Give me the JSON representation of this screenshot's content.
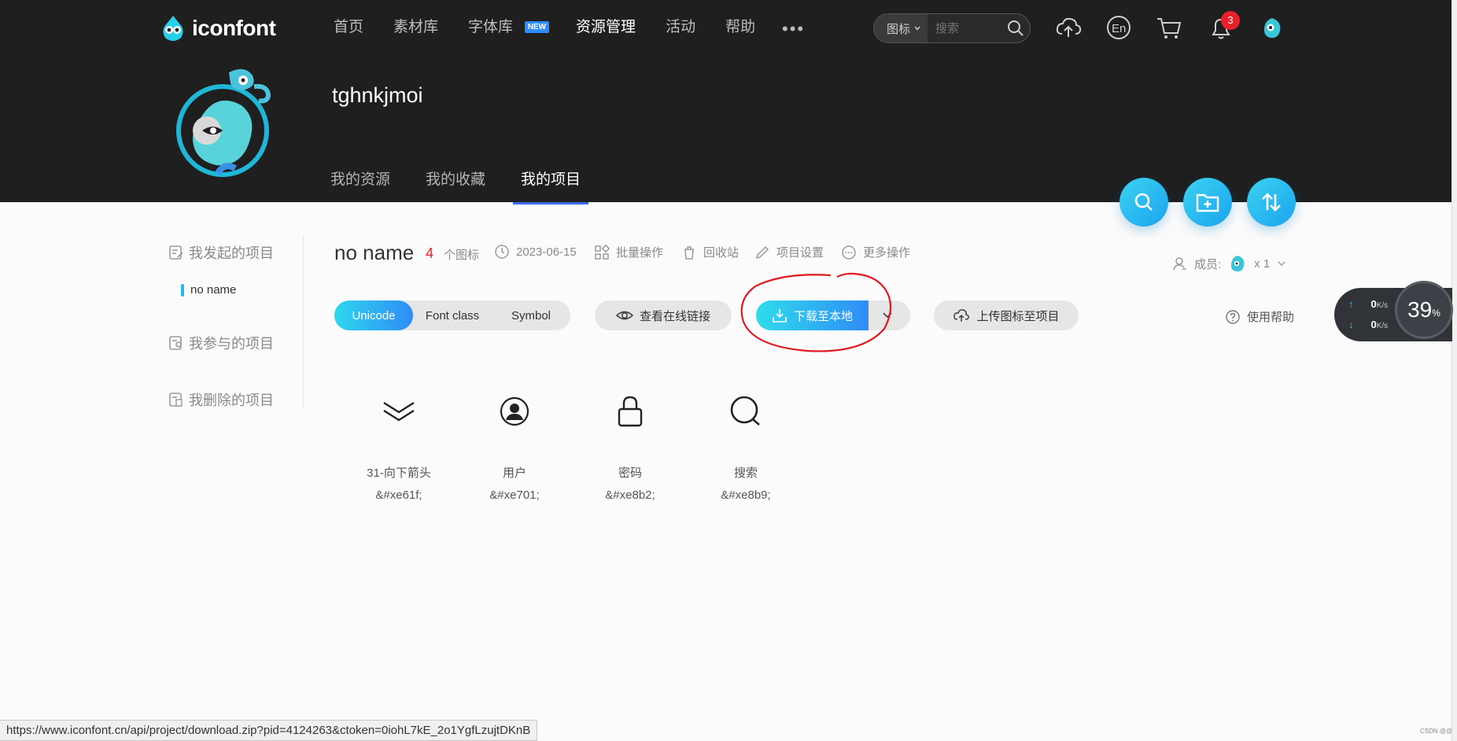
{
  "brand": {
    "name": "iconfont"
  },
  "topnav": {
    "items": [
      {
        "label": "首页"
      },
      {
        "label": "素材库"
      },
      {
        "label": "字体库"
      },
      {
        "label": "资源管理"
      },
      {
        "label": "活动"
      },
      {
        "label": "帮助"
      }
    ],
    "new_badge": "NEW",
    "more": "•••"
  },
  "search": {
    "type_label": "图标",
    "placeholder": "搜索"
  },
  "header_icons": [
    "upload-cloud-icon",
    "language-en-icon",
    "cart-icon",
    "bell-icon",
    "user-avatar"
  ],
  "notification_count": "3",
  "profile": {
    "username": "tghnkjmoi"
  },
  "subtabs": [
    {
      "label": "我的资源"
    },
    {
      "label": "我的收藏"
    },
    {
      "label": "我的项目"
    }
  ],
  "sidebar": {
    "groups": [
      {
        "label": "我发起的项目"
      },
      {
        "label": "我参与的项目"
      },
      {
        "label": "我删除的项目"
      }
    ],
    "project": "no name"
  },
  "project": {
    "title": "no name",
    "count": "4",
    "count_label": "个图标",
    "date": "2023-06-15",
    "actions": [
      "批量操作",
      "回收站",
      "项目设置",
      "更多操作"
    ],
    "members_label": "成员:",
    "members_count": "x 1"
  },
  "toolbar": {
    "modes": [
      "Unicode",
      "Font class",
      "Symbol"
    ],
    "view_link": "查看在线链接",
    "download": "下载至本地",
    "upload": "上传图标至项目",
    "help": "使用帮助"
  },
  "icons": [
    {
      "name": "31-向下箭头",
      "code": "&#xe61f;",
      "glyph": "double-chevron-down-icon"
    },
    {
      "name": "用户",
      "code": "&#xe701;",
      "glyph": "user-icon"
    },
    {
      "name": "密码",
      "code": "&#xe8b2;",
      "glyph": "lock-icon"
    },
    {
      "name": "搜索",
      "code": "&#xe8b9;",
      "glyph": "search-icon"
    }
  ],
  "speed_widget": {
    "up": "0",
    "down": "0",
    "unit": "K/s",
    "percent": "39",
    "percent_unit": "%"
  },
  "status_url": "https://www.iconfont.cn/api/project/download.zip?pid=4124263&ctoken=0iohL7kE_2o1YgfLzujtDKnB",
  "watermark": "CSDN @@",
  "colors": {
    "accent": "#2f8cf6",
    "accent_start": "#2fd6ee",
    "header_bg": "#1f1f1f",
    "badge": "#e8202a",
    "annotation": "#e0191f"
  }
}
